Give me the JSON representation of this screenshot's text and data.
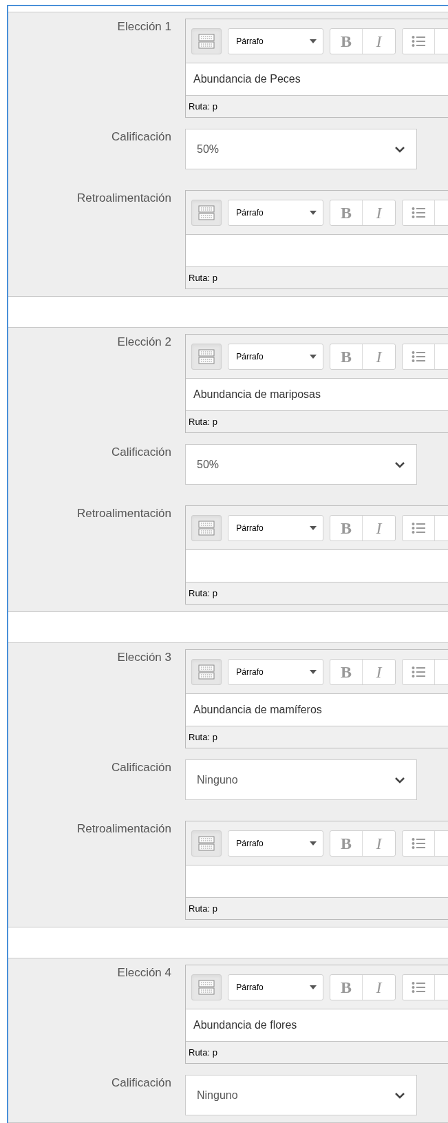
{
  "choices": [
    {
      "label": "Elección 1",
      "editor": {
        "format": "Párrafo",
        "bold": "B",
        "italic": "I",
        "content": "Abundancia de Peces",
        "path": "Ruta: p"
      },
      "grade": {
        "label": "Calificación",
        "value": "50%"
      },
      "feedback": {
        "label": "Retroalimentación",
        "editor": {
          "format": "Párrafo",
          "bold": "B",
          "italic": "I",
          "path": "Ruta: p"
        }
      }
    },
    {
      "label": "Elección 2",
      "editor": {
        "format": "Párrafo",
        "bold": "B",
        "italic": "I",
        "content": "Abundancia de mariposas",
        "path": "Ruta: p"
      },
      "grade": {
        "label": "Calificación",
        "value": "50%"
      },
      "feedback": {
        "label": "Retroalimentación",
        "editor": {
          "format": "Párrafo",
          "bold": "B",
          "italic": "I",
          "path": "Ruta: p"
        }
      }
    },
    {
      "label": "Elección 3",
      "editor": {
        "format": "Párrafo",
        "bold": "B",
        "italic": "I",
        "content": "Abundancia de mamíferos",
        "path": "Ruta: p"
      },
      "grade": {
        "label": "Calificación",
        "value": "Ninguno"
      },
      "feedback": {
        "label": "Retroalimentación",
        "editor": {
          "format": "Párrafo",
          "bold": "B",
          "italic": "I",
          "path": "Ruta: p"
        }
      }
    },
    {
      "label": "Elección 4",
      "editor": {
        "format": "Párrafo",
        "bold": "B",
        "italic": "I",
        "content": "Abundancia de flores",
        "path": "Ruta: p"
      },
      "grade": {
        "label": "Calificación",
        "value": "Ninguno"
      }
    }
  ]
}
